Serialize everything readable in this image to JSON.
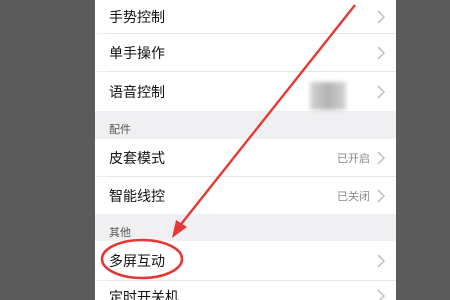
{
  "settings": {
    "rows_top": [
      {
        "label": "手势控制"
      },
      {
        "label": "单手操作"
      },
      {
        "label": "语音控制"
      }
    ],
    "section_accessory": "配件",
    "rows_accessory": [
      {
        "label": "皮套模式",
        "value": "已开启"
      },
      {
        "label": "智能线控",
        "value": "已关闭"
      }
    ],
    "section_other": "其他",
    "rows_other": [
      {
        "label": "多屏互动"
      },
      {
        "label": "定时开关机"
      }
    ]
  },
  "annotation": {
    "color": "#e53935"
  },
  "icons": {
    "chevron": "chevron-right-icon"
  }
}
